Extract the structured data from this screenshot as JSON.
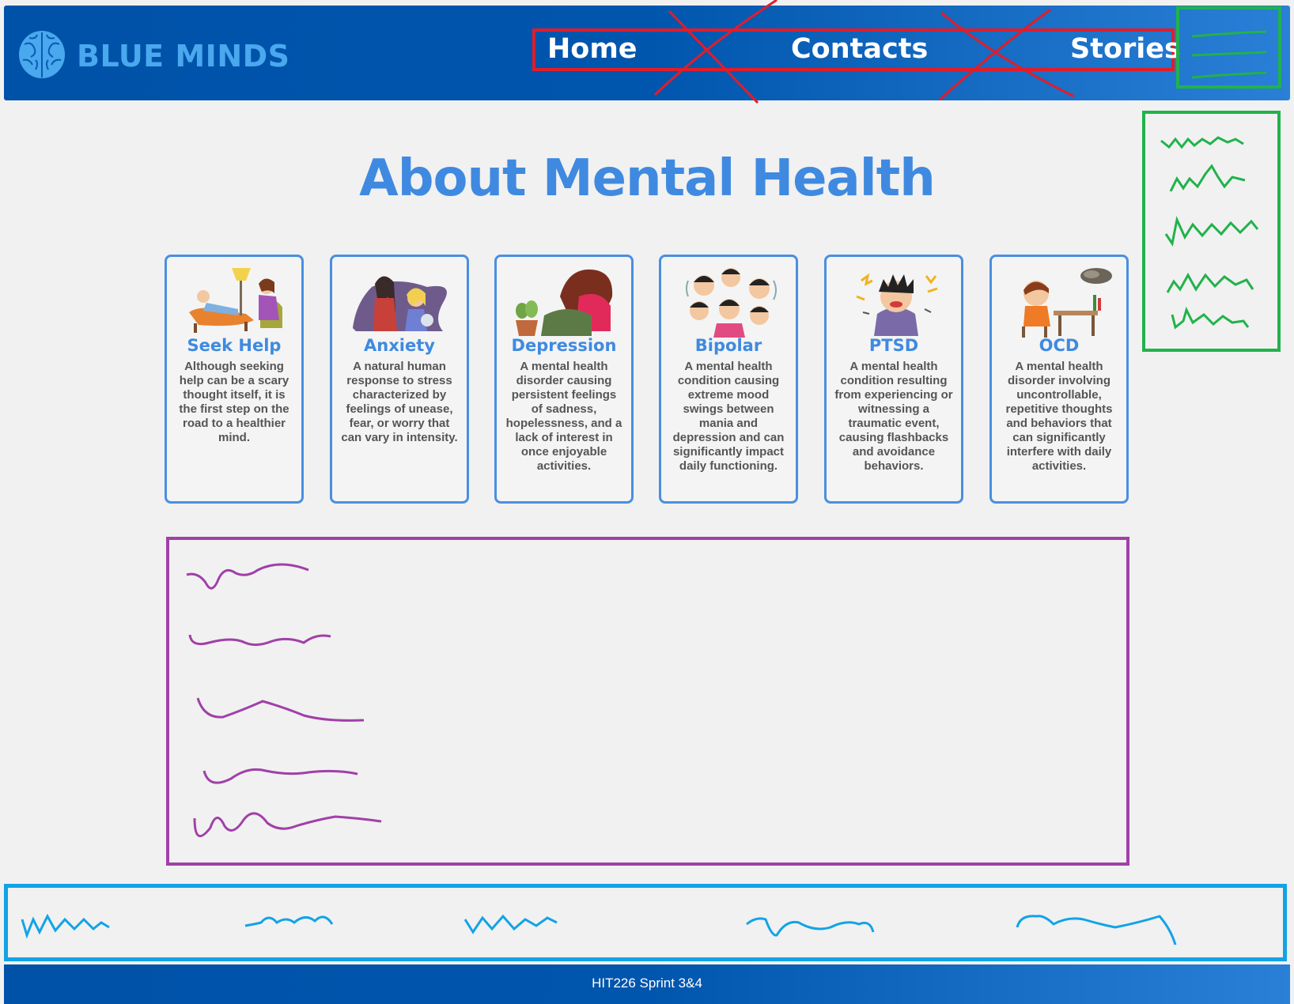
{
  "header": {
    "logo_text": "BLUE MINDS",
    "nav": {
      "home": "Home",
      "contacts": "Contacts",
      "stories": "Stories"
    }
  },
  "main": {
    "title": "About Mental Health",
    "cards": [
      {
        "title": "Seek Help",
        "icon": "therapy-session-icon",
        "desc": "Although seeking help can be a scary thought itself, it is the first step on the road to a healthier mind."
      },
      {
        "title": "Anxiety",
        "icon": "anxious-people-icon",
        "desc": "A natural human response to stress characterized by feelings of unease, fear, or worry that can vary in intensity."
      },
      {
        "title": "Depression",
        "icon": "sad-person-icon",
        "desc": "A mental health disorder causing persistent feelings of sadness, hopelessness, and a lack of interest in once enjoyable activities."
      },
      {
        "title": "Bipolar",
        "icon": "mood-swing-faces-icon",
        "desc": "A mental health condition causing extreme mood swings between mania and depression and can significantly impact daily functioning."
      },
      {
        "title": "PTSD",
        "icon": "stressed-person-icon",
        "desc": "A mental health condition resulting from experiencing or witnessing a traumatic event, causing flashbacks and avoidance behaviors."
      },
      {
        "title": "OCD",
        "icon": "worried-child-icon",
        "desc": "A mental health disorder involving uncontrollable, repetitive thoughts and behaviors that can significantly interfere with daily activities."
      }
    ]
  },
  "footer": {
    "text": "HIT226 Sprint 3&4"
  },
  "colors": {
    "header_gradient_start": "#0052a8",
    "header_gradient_end": "#2a7fd6",
    "accent": "#3f8ae0",
    "annotation_red": "#e11d2a",
    "annotation_green": "#21b24b",
    "annotation_purple": "#a040a8",
    "annotation_blue": "#12a3e6"
  }
}
